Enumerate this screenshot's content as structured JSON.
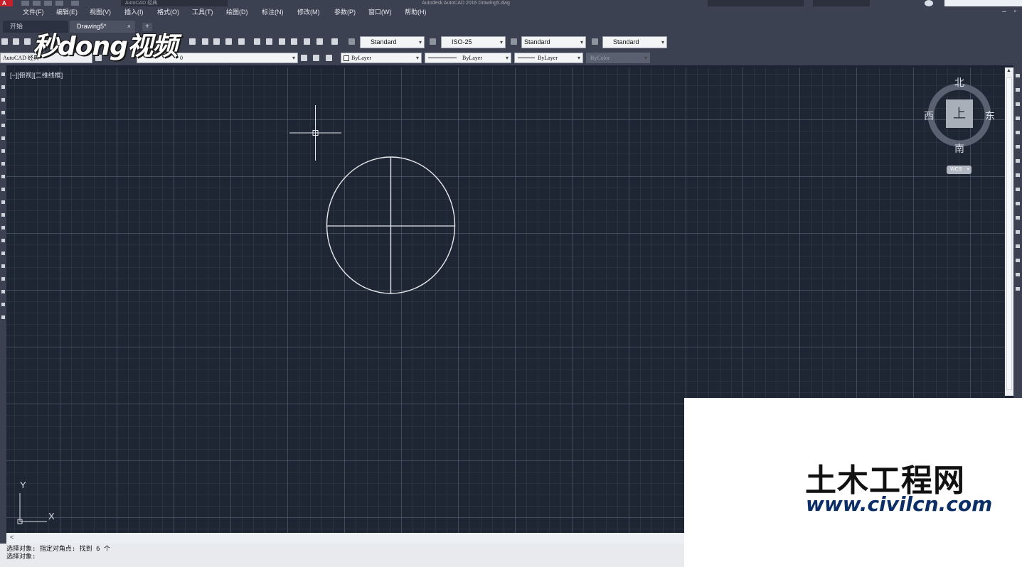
{
  "app": {
    "title": "Autodesk AutoCAD 2016   Drawing5.dwg",
    "app_button": "A",
    "workspace": "AutoCAD 经典"
  },
  "menu": [
    "文件(F)",
    "编辑(E)",
    "视图(V)",
    "插入(I)",
    "格式(O)",
    "工具(T)",
    "绘图(D)",
    "标注(N)",
    "修改(M)",
    "参数(P)",
    "窗口(W)",
    "帮助(H)"
  ],
  "tabs": [
    {
      "label": "开始",
      "active": false
    },
    {
      "label": "Drawing5*",
      "active": true,
      "close": "×"
    }
  ],
  "tab_add": "+",
  "styles_toolbar": {
    "text_style": "Standard",
    "dim_style": "ISO-25",
    "table_style": "Standard",
    "multileader_style": "Standard"
  },
  "layers_toolbar": {
    "workspace": "AutoCAD 经典",
    "layer": "0",
    "color": "ByLayer",
    "linetype": "ByLayer",
    "lineweight": "ByLayer",
    "plotstyle": "ByColor"
  },
  "viewport_label": "[−][俯视][二维线框]",
  "viewcube": {
    "north": "北",
    "south": "南",
    "east": "东",
    "west": "西",
    "top": "上",
    "wcs": "WCS",
    "wcs_arrow": "▾"
  },
  "ucs": {
    "x": "X",
    "y": "Y"
  },
  "scroll": {
    "left_arrow": "<",
    "up_arrow": "▲"
  },
  "command_history": [
    "选择对象: 指定对角点: 找到 6 个",
    "选择对象:"
  ],
  "watermark_top": "秒dong视频",
  "brand": {
    "name_cn": "土木工程网",
    "url": "www.civilcn.com",
    "primary_color": "#1d4e9c",
    "accent_color": "#6db33f"
  },
  "colors": {
    "canvas": "#1f2633",
    "chrome": "#3b4150",
    "geometry": "#e6e8ec"
  },
  "icons": [
    "new-icon",
    "open-icon",
    "save-icon",
    "pan-icon",
    "zoom-icon",
    "text-style-icon",
    "dim-style-icon",
    "table-style-icon",
    "multileader-style-icon",
    "layer-properties-icon"
  ]
}
